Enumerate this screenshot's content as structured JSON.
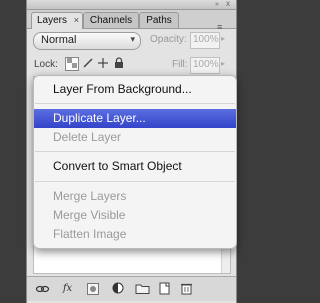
{
  "tabs": [
    {
      "label": "Layers"
    },
    {
      "label": "Channels"
    },
    {
      "label": "Paths"
    }
  ],
  "tab_close": "×",
  "panel_menu_icon": "≡",
  "titlebar": {
    "collapse": "»",
    "close": "x"
  },
  "blend_mode": {
    "value": "Normal",
    "arrow": "▾"
  },
  "opacity": {
    "label": "Opacity:",
    "value": "100%",
    "arrow": "▸"
  },
  "lock": {
    "label": "Lock:"
  },
  "fill": {
    "label": "Fill:",
    "value": "100%",
    "arrow": "▸"
  },
  "menu": {
    "items": [
      {
        "label": "Layer From Background...",
        "enabled": true
      },
      {
        "label": "Duplicate Layer...",
        "enabled": true,
        "highlighted": true
      },
      {
        "label": "Delete Layer",
        "enabled": false
      },
      {
        "label": "Convert to Smart Object",
        "enabled": true
      },
      {
        "label": "Merge Layers",
        "enabled": false
      },
      {
        "label": "Merge Visible",
        "enabled": false
      },
      {
        "label": "Flatten Image",
        "enabled": false
      }
    ]
  },
  "bottom_toolbar": {
    "fx_label": "fx"
  },
  "colors": {
    "menu_highlight": "#3b4fd6",
    "panel_bg": "#e3e3e3",
    "outside_bg": "#3c3c3c"
  }
}
